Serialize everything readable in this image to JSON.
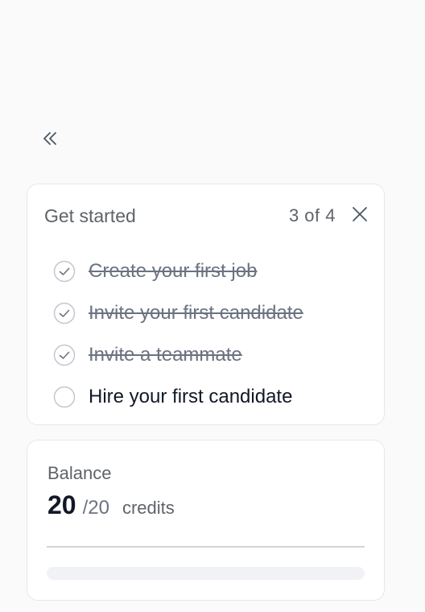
{
  "sidebar": {
    "collapse_icon": "double-chevron-left-icon"
  },
  "get_started": {
    "title": "Get started",
    "progress": "3 of 4",
    "close_icon": "close-icon",
    "tasks": [
      {
        "label": "Create your first job",
        "done": true
      },
      {
        "label": "Invite your first candidate",
        "done": true
      },
      {
        "label": "Invite a teammate",
        "done": true
      },
      {
        "label": "Hire your first candidate",
        "done": false
      }
    ]
  },
  "balance": {
    "label": "Balance",
    "current": "20",
    "total": "/20",
    "unit": "credits",
    "used_fraction": 0
  },
  "colors": {
    "check_done": "#6b7280",
    "check_border": "#c4c7cc",
    "bar_track": "#f1f2f6"
  }
}
